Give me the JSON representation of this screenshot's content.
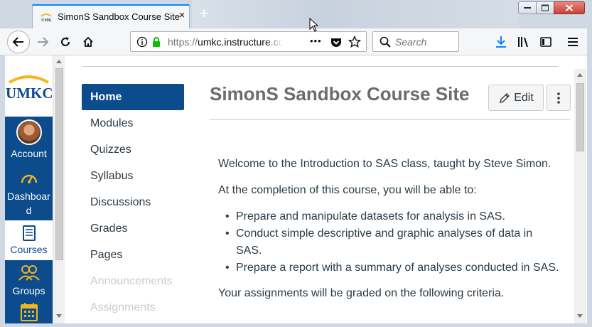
{
  "browser": {
    "tab_title": "SimonS Sandbox Course Site",
    "tab_close": "×",
    "new_tab": "+",
    "url_host_prefix": "https://",
    "url_host": "umkc.instructure.co",
    "url_more": "•••",
    "search_placeholder": "Search"
  },
  "global_nav": {
    "logo_text": "UMKC",
    "items": [
      {
        "label": "Account",
        "icon": "avatar"
      },
      {
        "label": "Dashboar d",
        "icon": "dashboard-icon"
      },
      {
        "label": "Courses",
        "icon": "courses-icon",
        "active": true
      },
      {
        "label": "Groups",
        "icon": "groups-icon"
      },
      {
        "label": "",
        "icon": "calendar-icon"
      }
    ]
  },
  "course_nav": {
    "items": [
      {
        "label": "Home",
        "active": true
      },
      {
        "label": "Modules"
      },
      {
        "label": "Quizzes"
      },
      {
        "label": "Syllabus"
      },
      {
        "label": "Discussions"
      },
      {
        "label": "Grades"
      },
      {
        "label": "Pages"
      },
      {
        "label": "Announcements",
        "disabled": true
      },
      {
        "label": "Assignments",
        "disabled": true
      }
    ]
  },
  "page": {
    "title": "SimonS Sandbox Course Site",
    "edit_label": "Edit",
    "intro": "Welcome to the Introduction to SAS class, taught by Steve Simon.",
    "objectives_lead": "At the completion of this course, you will be able to:",
    "objectives": [
      "Prepare and manipulate datasets for analysis in SAS.",
      "Conduct simple descriptive and graphic analyses of data in SAS.",
      "Prepare a report with a summary of analyses conducted in SAS."
    ],
    "grading_lead": "Your assignments will be graded on the following criteria."
  },
  "colors": {
    "brand_blue": "#0c4b8c",
    "firefox_accent": "#0a84ff",
    "umkc_gold": "#f5b51d"
  }
}
